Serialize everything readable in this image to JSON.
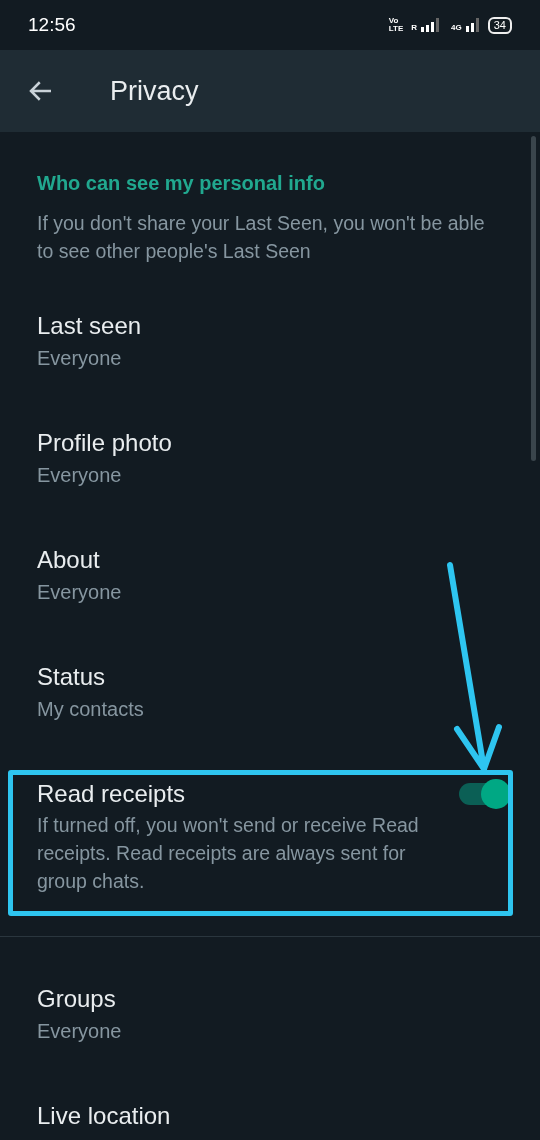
{
  "status_bar": {
    "time": "12:56",
    "volte": [
      "Vo",
      "LTE"
    ],
    "roaming": "R",
    "network": "4G",
    "battery": "34"
  },
  "app_bar": {
    "title": "Privacy"
  },
  "section": {
    "header": "Who can see my personal info",
    "description": "If you don't share your Last Seen, you won't be able to see other people's Last Seen"
  },
  "items": [
    {
      "kind": "choice",
      "title": "Last seen",
      "value": "Everyone",
      "highlighted": false
    },
    {
      "kind": "choice",
      "title": "Profile photo",
      "value": "Everyone",
      "highlighted": false
    },
    {
      "kind": "choice",
      "title": "About",
      "value": "Everyone",
      "highlighted": false
    },
    {
      "kind": "choice",
      "title": "Status",
      "value": "My contacts",
      "highlighted": false
    },
    {
      "kind": "toggle",
      "title": "Read receipts",
      "description": "If turned off, you won't send or receive Read receipts. Read receipts are always sent for group chats.",
      "on": true,
      "highlighted": true
    },
    {
      "kind": "divider"
    },
    {
      "kind": "choice",
      "title": "Groups",
      "value": "Everyone",
      "highlighted": false
    },
    {
      "kind": "choice",
      "title": "Live location",
      "highlighted": false
    }
  ]
}
